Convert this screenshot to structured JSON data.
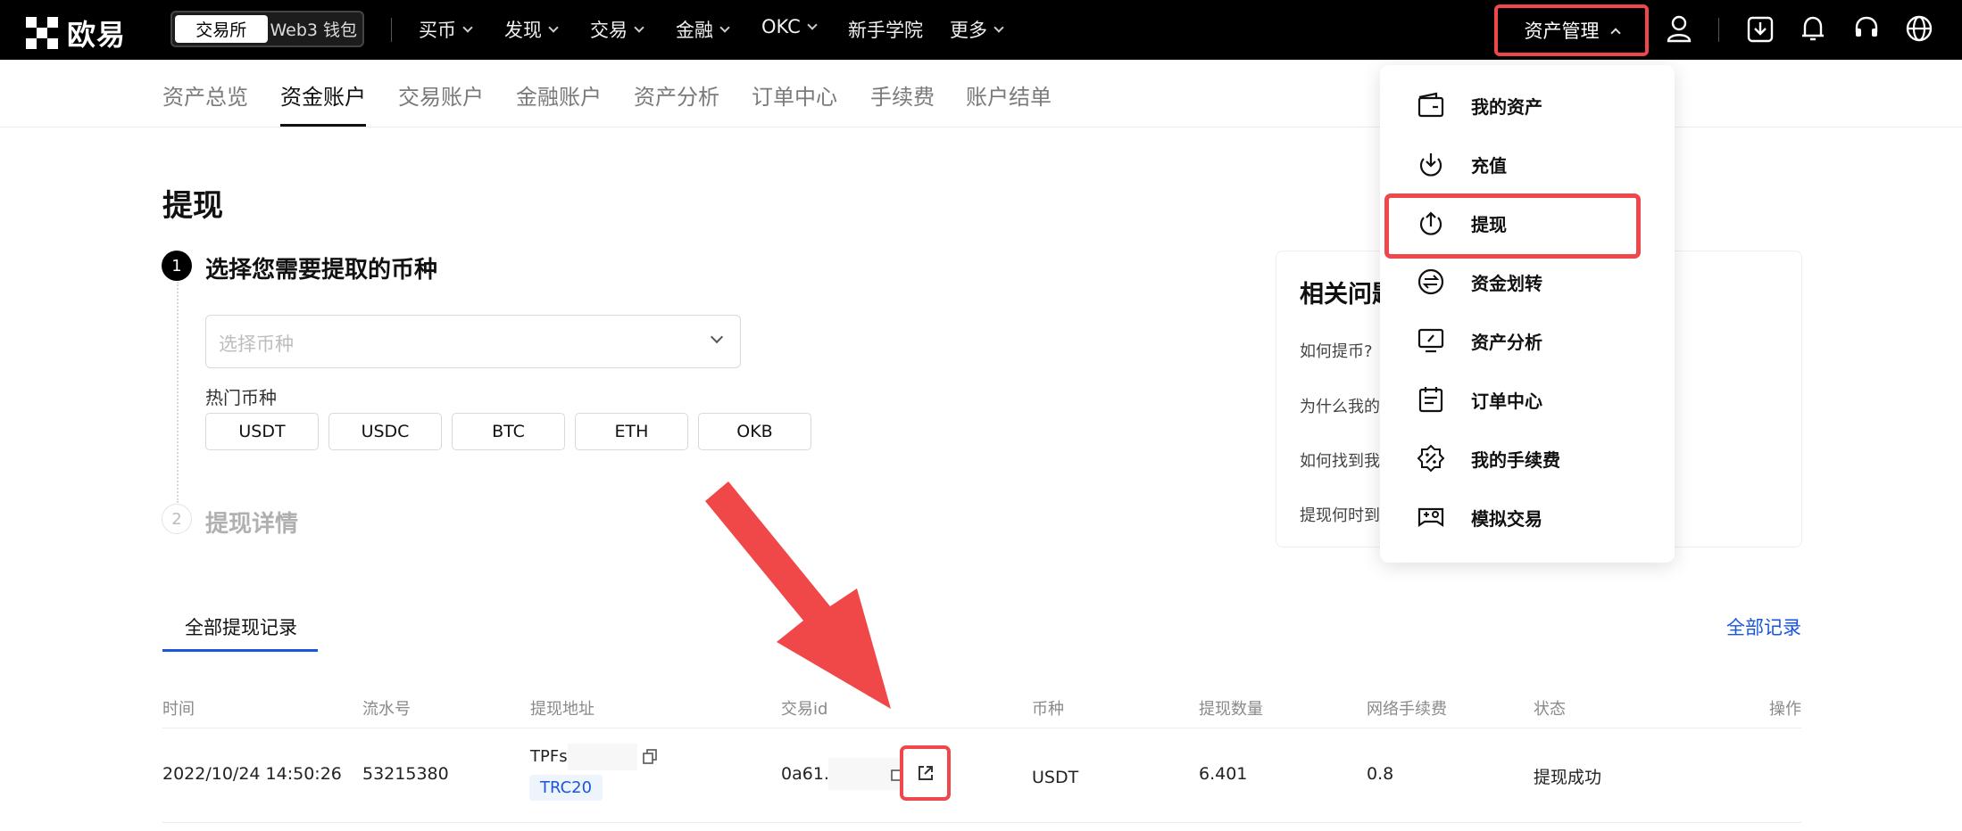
{
  "brand": {
    "name": "欧易"
  },
  "mode_switch": {
    "exchange": "交易所",
    "web3": "Web3 钱包"
  },
  "nav": {
    "buy": "买币",
    "discover": "发现",
    "trade": "交易",
    "finance": "金融",
    "okc": "OKC",
    "academy": "新手学院",
    "more": "更多"
  },
  "asset_menu_label": "资产管理",
  "subnav": {
    "tabs": [
      "资产总览",
      "资金账户",
      "交易账户",
      "金融账户",
      "资产分析",
      "订单中心",
      "手续费",
      "账户结单"
    ]
  },
  "page": {
    "title": "提现"
  },
  "steps": {
    "s1": {
      "num": "1",
      "title": "选择您需要提取的币种"
    },
    "s2": {
      "num": "2",
      "title": "提现详情"
    }
  },
  "coin_select": {
    "placeholder": "选择币种"
  },
  "hot_coins": {
    "label": "热门币种",
    "items": [
      "USDT",
      "USDC",
      "BTC",
      "ETH",
      "OKB"
    ]
  },
  "faq": {
    "title": "相关问题",
    "questions": [
      "如何提币?",
      "为什么我的",
      "如何找到我",
      "提现何时到"
    ]
  },
  "records": {
    "tab": "全部提现记录",
    "all_link": "全部记录",
    "columns": [
      "时间",
      "流水号",
      "提现地址",
      "交易id",
      "币种",
      "提现数量",
      "网络手续费",
      "状态",
      "操作"
    ],
    "row": {
      "time": "2022/10/24 14:50:26",
      "serial": "53215380",
      "address": "TPFs",
      "network": "TRC20",
      "txid": "0a61..",
      "coin": "USDT",
      "amount": "6.401",
      "fee": "0.8",
      "status": "提现成功"
    }
  },
  "dropdown": {
    "items": [
      "我的资产",
      "充值",
      "提现",
      "资金划转",
      "资产分析",
      "订单中心",
      "我的手续费",
      "模拟交易"
    ]
  },
  "colors": {
    "highlight": "#f0474a",
    "link": "#1a56db"
  }
}
